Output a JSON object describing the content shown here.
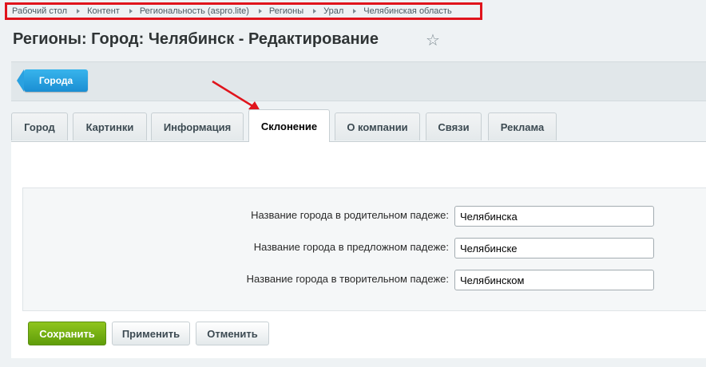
{
  "breadcrumb": [
    "Рабочий стол",
    "Контент",
    "Региональность (aspro.lite)",
    "Регионы",
    "Урал",
    "Челябинская область"
  ],
  "page": {
    "title": "Регионы: Город: Челябинск - Редактирование"
  },
  "icons": {
    "favorite": "star-icon"
  },
  "toolbar": {
    "cities_label": "Города"
  },
  "tabs": [
    {
      "label": "Город",
      "active": false
    },
    {
      "label": "Картинки",
      "active": false
    },
    {
      "label": "Информация",
      "active": false
    },
    {
      "label": "Склонение",
      "active": true
    },
    {
      "label": "О компании",
      "active": false
    },
    {
      "label": "Связи",
      "active": false
    },
    {
      "label": "Реклама",
      "active": false
    }
  ],
  "form": {
    "fields": [
      {
        "label": "Название города в родительном падеже:",
        "value": "Челябинска"
      },
      {
        "label": "Название города в предложном падеже:",
        "value": "Челябинске"
      },
      {
        "label": "Название города в творительном падеже:",
        "value": "Челябинском"
      }
    ]
  },
  "actions": {
    "save": "Сохранить",
    "apply": "Применить",
    "cancel": "Отменить"
  },
  "colors": {
    "accent_blue": "#1a8ed3",
    "save_green": "#6aa90f",
    "highlight_red": "#e0141c"
  }
}
